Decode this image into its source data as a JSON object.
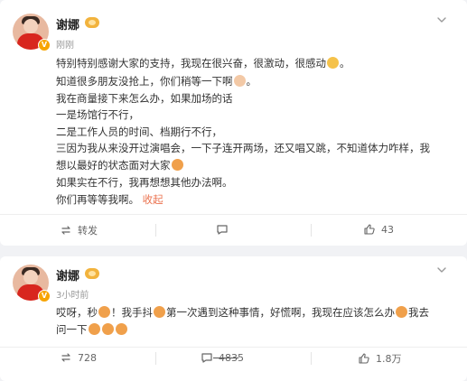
{
  "colors": {
    "accent": "#eb7350",
    "verified": "#f7a400",
    "background": "#f1f2f5"
  },
  "post1": {
    "author": "谢娜",
    "time": "刚刚",
    "lines": {
      "l1": "特别特别感谢大家的支持，我现在很兴奋，很激动，很感动",
      "l2": "知道很多朋友没抢上，你们稍等一下啊",
      "l3": "我在商量接下来怎么办，如果加场的话",
      "l4": "一是场馆行不行，",
      "l5": "二是工作人员的时间、档期行不行，",
      "l6": "三因为我从来没开过演唱会，一下子连开两场，还又唱又跳，不知道体力咋样，我",
      "l7": "想以最好的状态面对大家",
      "l8": "如果实在不行，我再想想其他办法啊。",
      "l9": "你们再等等我啊。"
    },
    "collapse": "收起",
    "emojis": [
      "sob-emoji",
      "hand-emoji",
      "face-emoji"
    ],
    "actions": {
      "repost": "转发",
      "comment": "",
      "like": "43"
    }
  },
  "post2": {
    "author": "谢娜",
    "time": "3小时前",
    "lines": {
      "l1a": "哎呀，秒",
      "l1b": "！我手抖",
      "l1c": "第一次遇到这种事情，好慌啊，我现在应该怎么办",
      "l1d": "我去",
      "l2": "问一下"
    },
    "actions": {
      "repost": "728",
      "comment": "4835",
      "like": "1.8万"
    }
  }
}
